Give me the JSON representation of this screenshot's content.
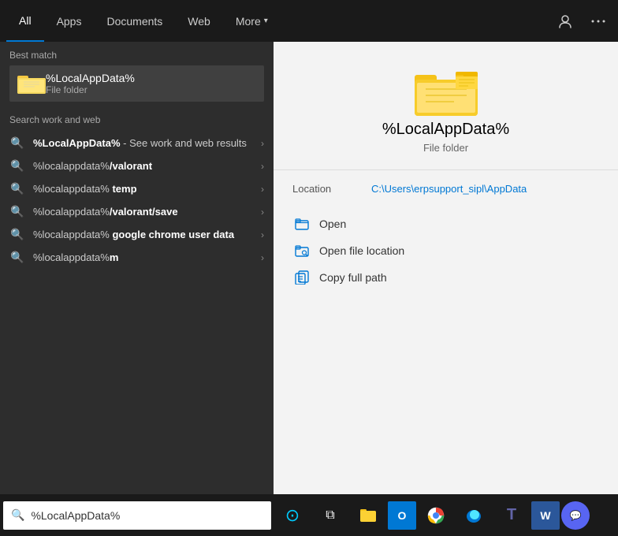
{
  "nav": {
    "tabs": [
      {
        "id": "all",
        "label": "All",
        "active": true
      },
      {
        "id": "apps",
        "label": "Apps"
      },
      {
        "id": "documents",
        "label": "Documents"
      },
      {
        "id": "web",
        "label": "Web"
      },
      {
        "id": "more",
        "label": "More"
      }
    ],
    "icon_person": "👤",
    "icon_more": "···"
  },
  "left": {
    "best_match_label": "Best match",
    "best_match": {
      "title": "%LocalAppData%",
      "subtitle": "File folder"
    },
    "search_web_label": "Search work and web",
    "items": [
      {
        "text_normal": "%LocalAppData%",
        "text_highlight": "",
        "suffix": " - See work and web results"
      },
      {
        "text_normal": "%localappdata%",
        "text_highlight": "/valorant",
        "suffix": ""
      },
      {
        "text_normal": "%localappdata%",
        "text_highlight": " temp",
        "suffix": ""
      },
      {
        "text_normal": "%localappdata%",
        "text_highlight": "/valorant/save",
        "suffix": ""
      },
      {
        "text_normal": "%localappdata%",
        "text_highlight": " google chrome user data",
        "suffix": ""
      },
      {
        "text_normal": "%localappdata%",
        "text_highlight": "m",
        "suffix": ""
      }
    ]
  },
  "right": {
    "title": "%LocalAppData%",
    "subtitle": "File folder",
    "location_label": "Location",
    "location_value": "C:\\Users\\erpsupport_sipl\\AppData",
    "actions": [
      {
        "id": "open",
        "label": "Open",
        "icon": "folder-open"
      },
      {
        "id": "open-file-location",
        "label": "Open file location",
        "icon": "folder-location"
      },
      {
        "id": "copy-full-path",
        "label": "Copy full path",
        "icon": "copy-path"
      }
    ]
  },
  "taskbar": {
    "search_text": "%LocalAppData%",
    "search_placeholder": "%LocalAppData%"
  }
}
